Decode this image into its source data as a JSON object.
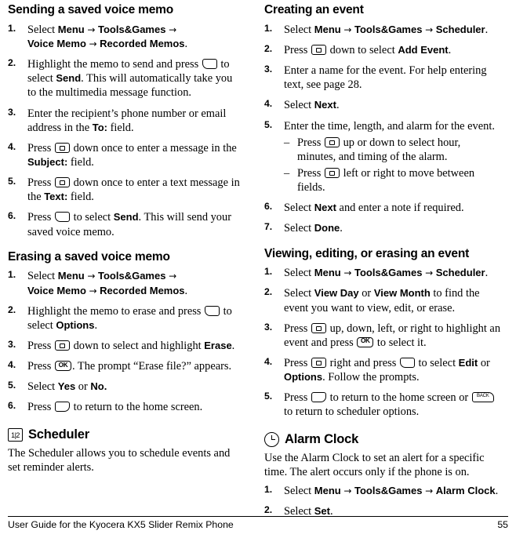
{
  "document": {
    "footer": {
      "left": "User Guide for the Kyocera KX5 Slider Remix Phone",
      "page_number": "55"
    }
  },
  "left_column": {
    "sections": [
      {
        "heading": "Sending a saved voice memo",
        "steps": [
          {
            "num": "1.",
            "parts": [
              {
                "t": "Select "
              },
              {
                "b": "Menu"
              },
              {
                "t": " "
              },
              {
                "a": "→"
              },
              {
                "t": " "
              },
              {
                "b": "Tools&Games"
              },
              {
                "t": " "
              },
              {
                "a": "→"
              },
              {
                "t": " "
              },
              {
                "br": true
              },
              {
                "b": "Voice Memo"
              },
              {
                "t": " "
              },
              {
                "a": "→"
              },
              {
                "t": " "
              },
              {
                "b": "Recorded Memos"
              },
              {
                "t": "."
              }
            ]
          },
          {
            "num": "2.",
            "parts": [
              {
                "t": "Highlight the memo to send and press "
              },
              {
                "k": "soft-l"
              },
              {
                "t": " to select "
              },
              {
                "b": "Send"
              },
              {
                "t": ". This will automatically take you to the multimedia message function."
              }
            ]
          },
          {
            "num": "3.",
            "parts": [
              {
                "t": "Enter the recipient’s phone number or email address in the "
              },
              {
                "b": "To:"
              },
              {
                "t": " field."
              }
            ]
          },
          {
            "num": "4.",
            "parts": [
              {
                "t": "Press "
              },
              {
                "k": "nav"
              },
              {
                "t": " down once to enter a message in the "
              },
              {
                "b": "Subject:"
              },
              {
                "t": " field."
              }
            ]
          },
          {
            "num": "5.",
            "parts": [
              {
                "t": "Press "
              },
              {
                "k": "nav"
              },
              {
                "t": " down once to enter a text message in the "
              },
              {
                "b": "Text:"
              },
              {
                "t": " field."
              }
            ]
          },
          {
            "num": "6.",
            "parts": [
              {
                "t": "Press "
              },
              {
                "k": "soft-l"
              },
              {
                "t": " to select "
              },
              {
                "b": "Send"
              },
              {
                "t": ". This will send your saved voice memo."
              }
            ]
          }
        ]
      },
      {
        "heading": "Erasing a saved voice memo",
        "steps": [
          {
            "num": "1.",
            "parts": [
              {
                "t": "Select "
              },
              {
                "b": "Menu"
              },
              {
                "t": " "
              },
              {
                "a": "→"
              },
              {
                "t": " "
              },
              {
                "b": "Tools&Games"
              },
              {
                "t": " "
              },
              {
                "a": "→"
              },
              {
                "t": " "
              },
              {
                "br": true
              },
              {
                "b": "Voice Memo"
              },
              {
                "t": " "
              },
              {
                "a": "→"
              },
              {
                "t": " "
              },
              {
                "b": "Recorded Memos"
              },
              {
                "t": "."
              }
            ]
          },
          {
            "num": "2.",
            "parts": [
              {
                "t": "Highlight the memo to erase and press "
              },
              {
                "k": "soft-l"
              },
              {
                "t": " to select "
              },
              {
                "b": "Options"
              },
              {
                "t": "."
              }
            ]
          },
          {
            "num": "3.",
            "parts": [
              {
                "t": "Press "
              },
              {
                "k": "nav"
              },
              {
                "t": " down to select and highlight "
              },
              {
                "b": "Erase"
              },
              {
                "t": "."
              }
            ]
          },
          {
            "num": "4.",
            "parts": [
              {
                "t": "Press "
              },
              {
                "k": "ok"
              },
              {
                "t": ". The prompt “Erase file?” appears."
              }
            ]
          },
          {
            "num": "5.",
            "parts": [
              {
                "t": "Select "
              },
              {
                "b": "Yes"
              },
              {
                "t": " or "
              },
              {
                "b": "No."
              }
            ]
          },
          {
            "num": "6.",
            "parts": [
              {
                "t": "Press "
              },
              {
                "k": "soft-r"
              },
              {
                "t": " to return to the home screen."
              }
            ]
          }
        ]
      }
    ],
    "scheduler": {
      "icon": "scheduler-icon",
      "icon_label": "1|2",
      "heading": "Scheduler",
      "body": "The Scheduler allows you to schedule events and set reminder alerts."
    }
  },
  "right_column": {
    "sections": [
      {
        "heading": "Creating an event",
        "steps": [
          {
            "num": "1.",
            "parts": [
              {
                "t": "Select "
              },
              {
                "b": "Menu"
              },
              {
                "t": " "
              },
              {
                "a": "→"
              },
              {
                "t": " "
              },
              {
                "b": "Tools&Games"
              },
              {
                "t": " "
              },
              {
                "a": "→"
              },
              {
                "t": " "
              },
              {
                "b": "Scheduler"
              },
              {
                "t": "."
              }
            ]
          },
          {
            "num": "2.",
            "parts": [
              {
                "t": "Press "
              },
              {
                "k": "nav"
              },
              {
                "t": " down to select "
              },
              {
                "b": "Add Event"
              },
              {
                "t": "."
              }
            ]
          },
          {
            "num": "3.",
            "parts": [
              {
                "t": "Enter a name for the event. For help entering text, see page 28."
              }
            ]
          },
          {
            "num": "4.",
            "parts": [
              {
                "t": "Select "
              },
              {
                "b": "Next"
              },
              {
                "t": "."
              }
            ]
          },
          {
            "num": "5.",
            "parts": [
              {
                "t": "Enter the time, length, and alarm for the event."
              }
            ],
            "sub": [
              {
                "dash": "–",
                "parts": [
                  {
                    "t": "Press "
                  },
                  {
                    "k": "nav"
                  },
                  {
                    "t": " up or down to select hour, minutes, and timing of the alarm."
                  }
                ]
              },
              {
                "dash": "–",
                "parts": [
                  {
                    "t": "Press "
                  },
                  {
                    "k": "nav"
                  },
                  {
                    "t": " left or right to move between fields."
                  }
                ]
              }
            ]
          },
          {
            "num": "6.",
            "parts": [
              {
                "t": "Select "
              },
              {
                "b": "Next"
              },
              {
                "t": " and enter a note if required."
              }
            ]
          },
          {
            "num": "7.",
            "parts": [
              {
                "t": "Select "
              },
              {
                "b": "Done"
              },
              {
                "t": "."
              }
            ]
          }
        ]
      },
      {
        "heading": "Viewing, editing, or erasing an event",
        "steps": [
          {
            "num": "1.",
            "parts": [
              {
                "t": "Select "
              },
              {
                "b": "Menu"
              },
              {
                "t": " "
              },
              {
                "a": "→"
              },
              {
                "t": " "
              },
              {
                "b": "Tools&Games"
              },
              {
                "t": " "
              },
              {
                "a": "→"
              },
              {
                "t": " "
              },
              {
                "b": "Scheduler"
              },
              {
                "t": "."
              }
            ]
          },
          {
            "num": "2.",
            "parts": [
              {
                "t": "Select "
              },
              {
                "b": "View Day"
              },
              {
                "t": " or "
              },
              {
                "b": "View Month"
              },
              {
                "t": " to find the event you want to view, edit, or erase."
              }
            ]
          },
          {
            "num": "3.",
            "parts": [
              {
                "t": "Press "
              },
              {
                "k": "nav"
              },
              {
                "t": " up, down, left, or right to highlight an event and press "
              },
              {
                "k": "ok"
              },
              {
                "t": " to select it."
              }
            ]
          },
          {
            "num": "4.",
            "parts": [
              {
                "t": "Press "
              },
              {
                "k": "nav"
              },
              {
                "t": " right and press "
              },
              {
                "k": "soft-l"
              },
              {
                "t": " to select "
              },
              {
                "b": "Edit"
              },
              {
                "t": " or "
              },
              {
                "b": "Options"
              },
              {
                "t": ". Follow the prompts."
              }
            ]
          },
          {
            "num": "5.",
            "parts": [
              {
                "t": "Press "
              },
              {
                "k": "soft-r"
              },
              {
                "t": " to return to the home screen or "
              },
              {
                "k": "back"
              },
              {
                "t": " to return to scheduler options."
              }
            ]
          }
        ]
      }
    ],
    "alarm": {
      "icon": "alarm-clock-icon",
      "heading": "Alarm Clock",
      "body": "Use the Alarm Clock to set an alert for a specific time. The alert occurs only if the phone is on.",
      "steps": [
        {
          "num": "1.",
          "parts": [
            {
              "t": "Select "
            },
            {
              "b": "Menu"
            },
            {
              "t": " "
            },
            {
              "a": "→"
            },
            {
              "t": " "
            },
            {
              "b": "Tools&Games"
            },
            {
              "t": " "
            },
            {
              "a": "→"
            },
            {
              "t": " "
            },
            {
              "b": "Alarm Clock"
            },
            {
              "t": "."
            }
          ]
        },
        {
          "num": "2.",
          "parts": [
            {
              "t": "Select "
            },
            {
              "b": "Set"
            },
            {
              "t": "."
            }
          ]
        }
      ]
    }
  }
}
